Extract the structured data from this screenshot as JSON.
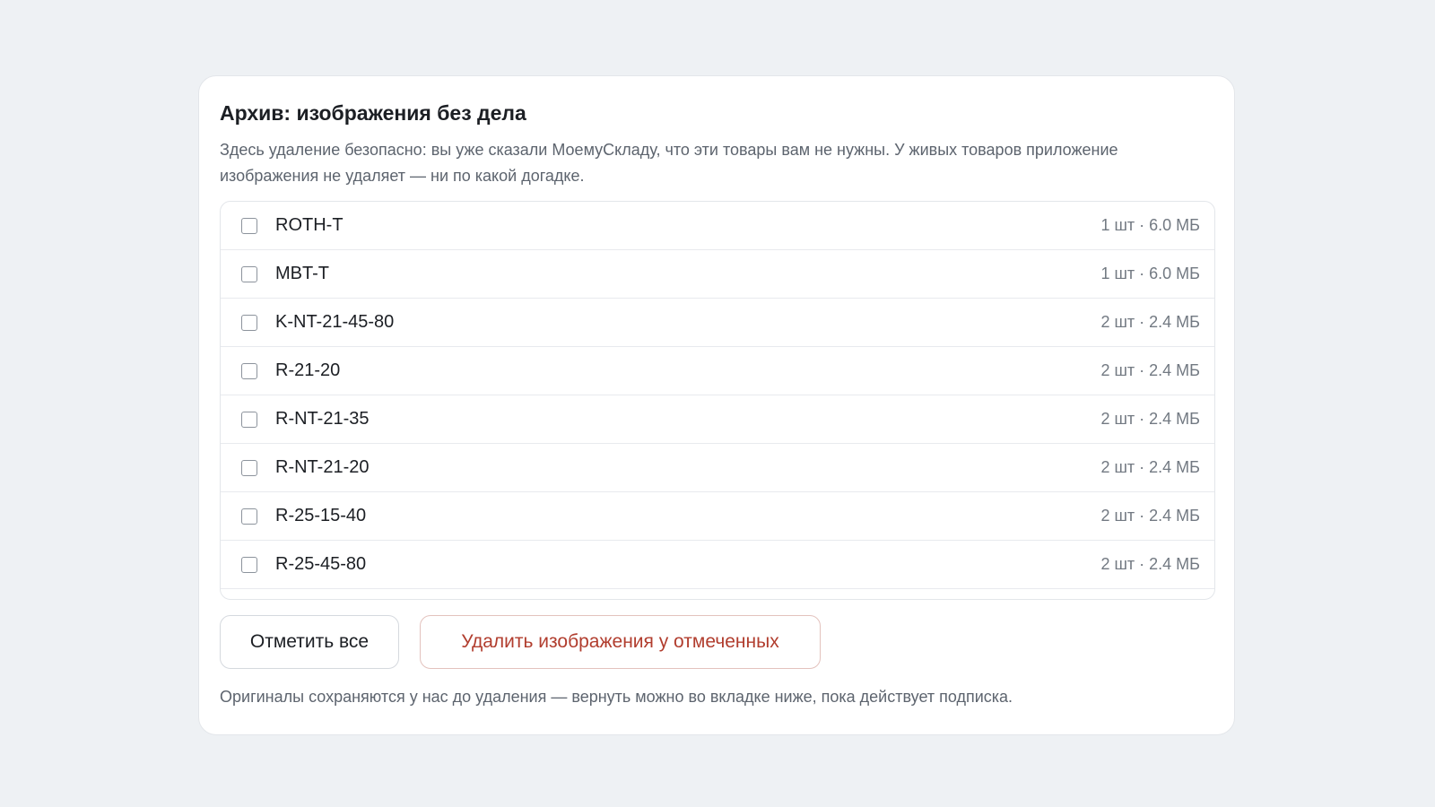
{
  "archive": {
    "title": "Архив: изображения без дела",
    "description": "Здесь удаление безопасно: вы уже сказали МоемуСкладу, что эти товары вам не нужны. У живых товаров приложение изображения не удаляет — ни по какой догадке.",
    "items": [
      {
        "sku": "ROTH-T",
        "meta": "1 шт · 6.0 МБ",
        "checked": false
      },
      {
        "sku": "MBT-T",
        "meta": "1 шт · 6.0 МБ",
        "checked": false
      },
      {
        "sku": "K-NT-21-45-80",
        "meta": "2 шт · 2.4 МБ",
        "checked": false
      },
      {
        "sku": "R-21-20",
        "meta": "2 шт · 2.4 МБ",
        "checked": false
      },
      {
        "sku": "R-NT-21-35",
        "meta": "2 шт · 2.4 МБ",
        "checked": false
      },
      {
        "sku": "R-NT-21-20",
        "meta": "2 шт · 2.4 МБ",
        "checked": false
      },
      {
        "sku": "R-25-15-40",
        "meta": "2 шт · 2.4 МБ",
        "checked": false
      },
      {
        "sku": "R-25-45-80",
        "meta": "2 шт · 2.4 МБ",
        "checked": false
      }
    ],
    "select_all_label": "Отметить все",
    "delete_label": "Удалить изображения у отмеченных",
    "footnote": "Оригиналы сохраняются у нас до удаления — вернуть можно во вкладке ниже, пока действует подписка."
  },
  "colors": {
    "background": "#eef1f4",
    "card": "#ffffff",
    "danger": "#b13d2e",
    "muted_text": "#5d646e"
  },
  "icons": {
    "row_checkbox": "checkbox-unchecked-icon"
  }
}
